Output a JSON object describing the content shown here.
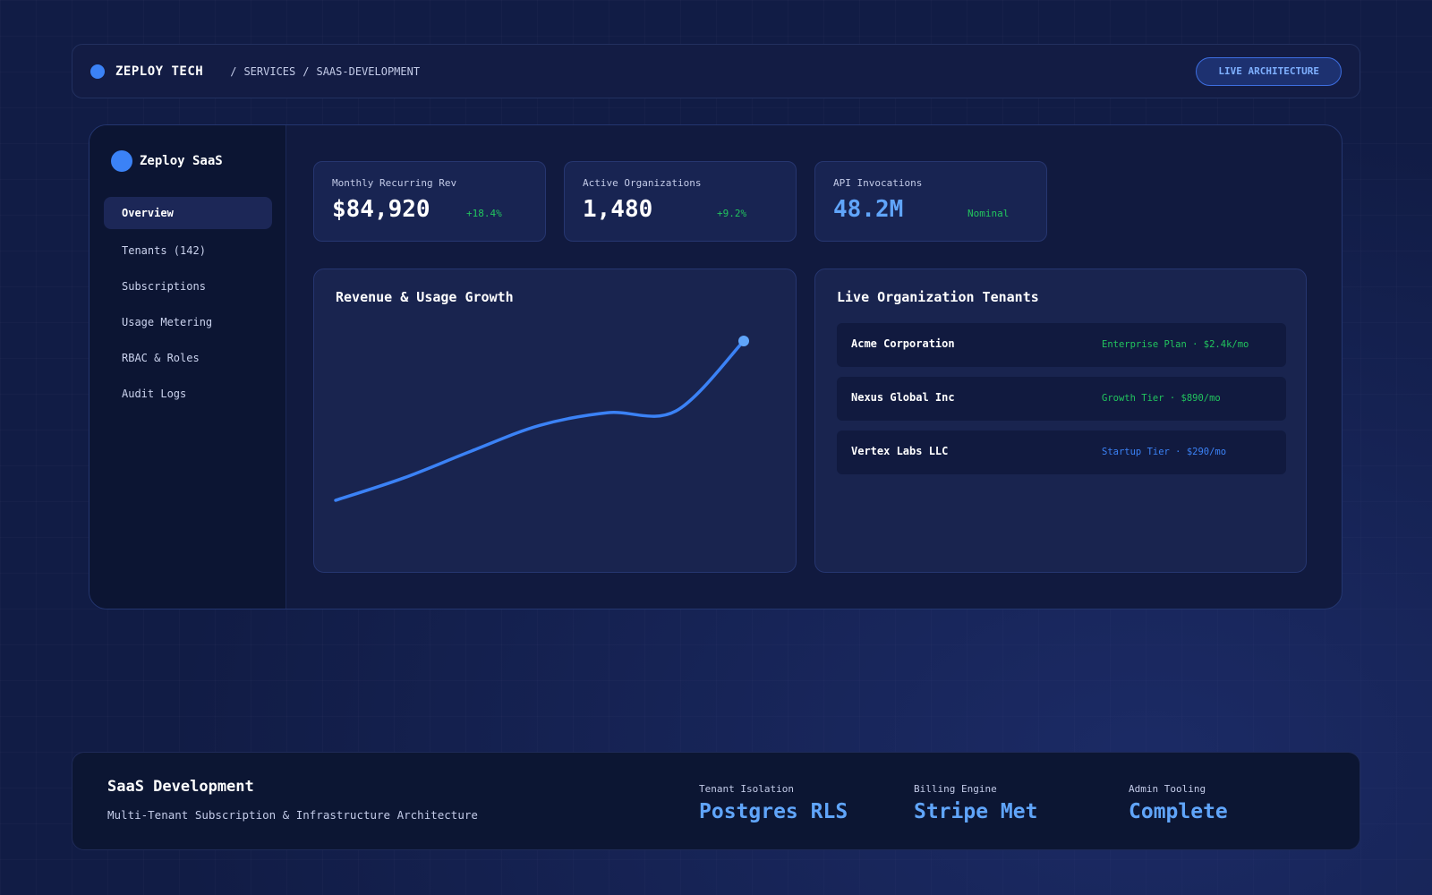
{
  "topbar": {
    "brand": "ZEPLOY TECH",
    "breadcrumb": [
      "/",
      "SERVICES",
      "/",
      "SAAS-DEVELOPMENT"
    ],
    "live_button": "LIVE ARCHITECTURE"
  },
  "sidebar": {
    "title": "Zeploy SaaS",
    "items": [
      {
        "label": "Overview",
        "active": true
      },
      {
        "label": "Tenants (142)"
      },
      {
        "label": "Subscriptions"
      },
      {
        "label": "Usage Metering"
      },
      {
        "label": "RBAC & Roles"
      },
      {
        "label": "Audit Logs"
      }
    ]
  },
  "stats": [
    {
      "label": "Monthly Recurring Rev",
      "value": "$84,920",
      "delta": "+18.4%"
    },
    {
      "label": "Active Organizations",
      "value": "1,480",
      "delta": "+9.2%"
    },
    {
      "label": "API Invocations",
      "value": "48.2M",
      "delta": "Nominal"
    }
  ],
  "chart_card": {
    "title": "Revenue & Usage Growth"
  },
  "chart_data": {
    "type": "line",
    "title": "Revenue & Usage Growth",
    "xlabel": "",
    "ylabel": "",
    "grid": false,
    "color": "#3b82f6",
    "x": [
      0,
      1,
      2,
      3,
      4,
      5,
      6
    ],
    "y": [
      0,
      14,
      31,
      47,
      55,
      56,
      100
    ]
  },
  "tenants_card": {
    "title": "Live Organization Tenants",
    "rows": [
      {
        "name": "Acme Corporation",
        "plan": "Enterprise Plan · $2.4k/mo",
        "color": "#22c55e"
      },
      {
        "name": "Nexus Global Inc",
        "plan": "Growth Tier · $890/mo",
        "color": "#22c55e"
      },
      {
        "name": "Vertex Labs LLC",
        "plan": "Startup Tier · $290/mo",
        "color": "#3b82f6"
      }
    ]
  },
  "footer": {
    "title": "SaaS Development",
    "subtitle": "Multi-Tenant Subscription & Infrastructure Architecture",
    "metrics": [
      {
        "label": "Tenant Isolation",
        "value": "Postgres RLS"
      },
      {
        "label": "Billing Engine",
        "value": "Stripe Met"
      },
      {
        "label": "Admin Tooling",
        "value": "Complete"
      }
    ]
  },
  "colors": {
    "accent": "#3b82f6",
    "accent_light": "#60a5fa",
    "positive": "#22c55e",
    "background": "#111c45"
  },
  "icons": [
    "brand-dot-icon",
    "sidebar-logo-icon"
  ]
}
